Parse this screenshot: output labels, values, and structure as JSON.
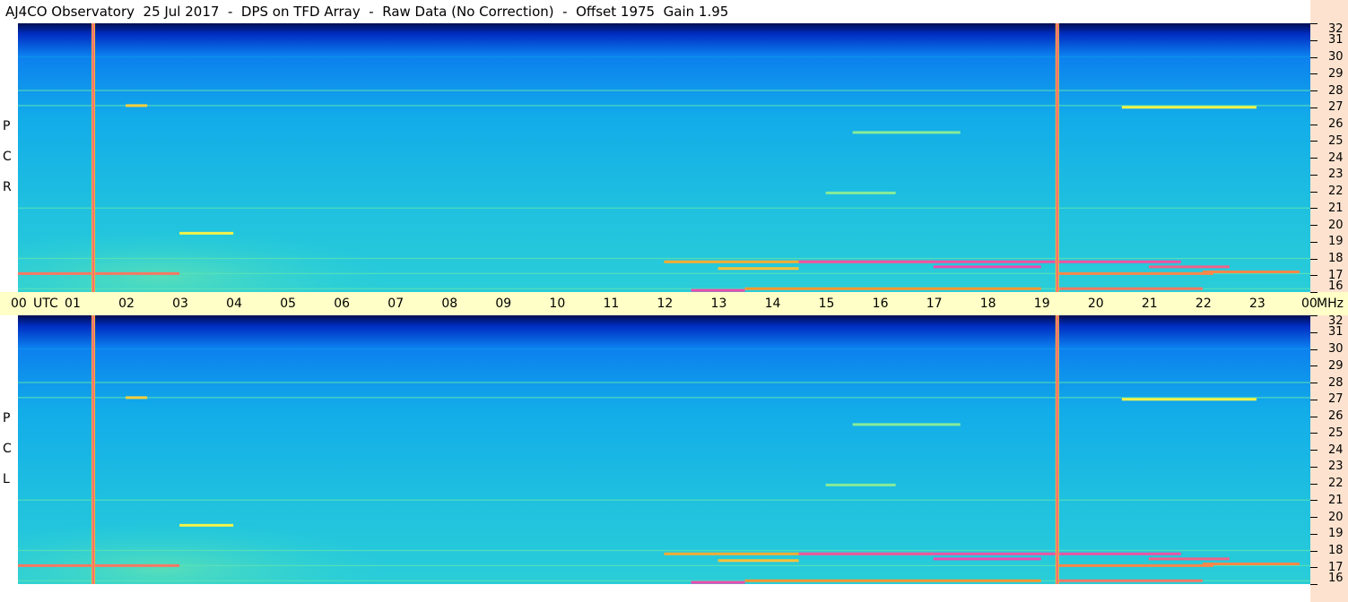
{
  "header": {
    "title": "AJ4CO Observatory  25 Jul 2017  -  DPS on TFD Array  -  Raw Data (No Correction)  -  Offset 1975  Gain 1.95"
  },
  "colors": {
    "axis_band": "#ffffc7",
    "freq_strip": "#fde3cf",
    "palette": [
      "#00083a",
      "#0030c8",
      "#0a6ef0",
      "#13b4e8",
      "#35d9d0",
      "#9cf08a",
      "#f2f24a",
      "#ff9a2a",
      "#e83cc8"
    ]
  },
  "chart_data": {
    "type": "heatmap",
    "title": "AJ4CO Observatory  25 Jul 2017  -  DPS on TFD Array  -  Raw Data (No Correction)  -  Offset 1975  Gain 1.95",
    "x_axis": {
      "unit_label": "UTC",
      "ticks": [
        "00",
        "01",
        "02",
        "03",
        "04",
        "05",
        "06",
        "07",
        "08",
        "09",
        "10",
        "11",
        "12",
        "13",
        "14",
        "15",
        "16",
        "17",
        "18",
        "19",
        "20",
        "21",
        "22",
        "23",
        "00"
      ],
      "range_hours": [
        0,
        24
      ]
    },
    "y_axis": {
      "unit_label": "MHz",
      "ticks": [
        "16",
        "17",
        "18",
        "19",
        "20",
        "21",
        "22",
        "23",
        "24",
        "25",
        "26",
        "27",
        "28",
        "29",
        "30",
        "31",
        "32"
      ],
      "range_mhz": [
        16,
        32
      ]
    },
    "panels": [
      {
        "name": "R C P",
        "letters": [
          "P",
          "C",
          "R"
        ]
      },
      {
        "name": "L C P",
        "letters": [
          "P",
          "C",
          "L"
        ]
      }
    ],
    "vertical_markers_utc": [
      1.4,
      19.3
    ],
    "persistent_lines_mhz": [
      30.0,
      28.0,
      27.1,
      21.0,
      18.0,
      17.1,
      16.2
    ],
    "rfi_bursts": [
      {
        "utc": [
          0.0,
          3.0
        ],
        "mhz": 17.1,
        "level": 0.92
      },
      {
        "utc": [
          12.0,
          17.0
        ],
        "mhz": 17.8,
        "level": 0.85
      },
      {
        "utc": [
          14.5,
          19.3
        ],
        "mhz": 17.8,
        "level": 0.97
      },
      {
        "utc": [
          17.0,
          19.0
        ],
        "mhz": 17.5,
        "level": 0.98
      },
      {
        "utc": [
          19.3,
          21.6
        ],
        "mhz": 17.8,
        "level": 0.97
      },
      {
        "utc": [
          19.3,
          22.2
        ],
        "mhz": 17.1,
        "level": 0.9
      },
      {
        "utc": [
          12.5,
          13.5
        ],
        "mhz": 16.1,
        "level": 0.98
      },
      {
        "utc": [
          13.5,
          19.0
        ],
        "mhz": 16.2,
        "level": 0.88
      },
      {
        "utc": [
          19.3,
          22.0
        ],
        "mhz": 16.2,
        "level": 0.92
      },
      {
        "utc": [
          21.0,
          22.5
        ],
        "mhz": 17.5,
        "level": 0.95
      },
      {
        "utc": [
          22.0,
          23.8
        ],
        "mhz": 17.2,
        "level": 0.9
      },
      {
        "utc": [
          13.0,
          14.5
        ],
        "mhz": 17.4,
        "level": 0.82
      },
      {
        "utc": [
          2.0,
          2.4
        ],
        "mhz": 27.1,
        "level": 0.8
      },
      {
        "utc": [
          20.5,
          23.0
        ],
        "mhz": 27.0,
        "level": 0.75
      },
      {
        "utc": [
          15.5,
          17.5
        ],
        "mhz": 25.5,
        "level": 0.6
      },
      {
        "utc": [
          3.0,
          4.0
        ],
        "mhz": 19.5,
        "level": 0.75
      },
      {
        "utc": [
          15.0,
          16.3
        ],
        "mhz": 21.9,
        "level": 0.6
      }
    ]
  }
}
